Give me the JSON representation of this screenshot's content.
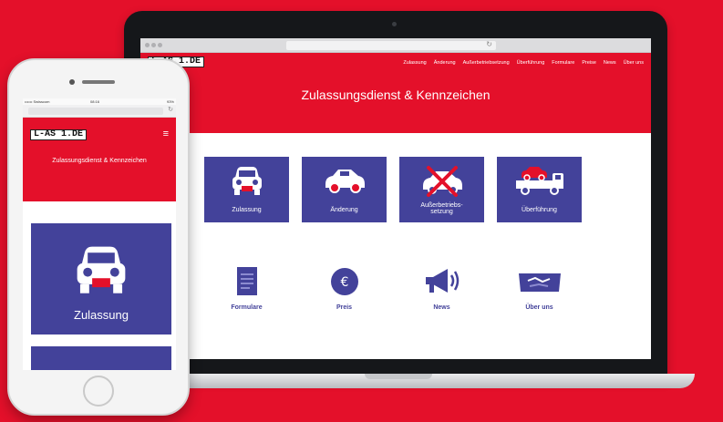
{
  "colors": {
    "brand_red": "#e4102a",
    "tile_blue": "#43429a",
    "white": "#ffffff"
  },
  "logo_text": "L-AS 1.DE",
  "laptop": {
    "nav": [
      "Zulassung",
      "Änderung",
      "Außerbetriebsetzung",
      "Überführung",
      "Formulare",
      "Preise",
      "News",
      "Über uns"
    ],
    "hero_title": "Zulassungsdienst & Kennzeichen",
    "tiles": [
      {
        "label": "Zulassung",
        "icon": "car-front-icon"
      },
      {
        "label": "Änderung",
        "icon": "car-side-icon"
      },
      {
        "label_line1": "Außerbetriebs-",
        "label_line2": "setzung",
        "icon": "car-crossed-icon"
      },
      {
        "label": "Überführung",
        "icon": "tow-truck-icon"
      }
    ],
    "links": [
      {
        "label": "Formulare",
        "icon": "document-icon"
      },
      {
        "label": "Preis",
        "icon": "euro-icon"
      },
      {
        "label": "News",
        "icon": "megaphone-icon"
      },
      {
        "label": "Über uns",
        "icon": "handshake-icon"
      }
    ]
  },
  "phone": {
    "status": {
      "carrier": "•••••• Swisscom",
      "time": "08:16",
      "battery": "93%"
    },
    "reload_icon": "reload-icon",
    "menu_icon": "hamburger-menu-icon",
    "hero_title": "Zulassungsdienst & Kennzeichen",
    "tile_label": "Zulassung",
    "tile_icon": "car-front-icon"
  }
}
